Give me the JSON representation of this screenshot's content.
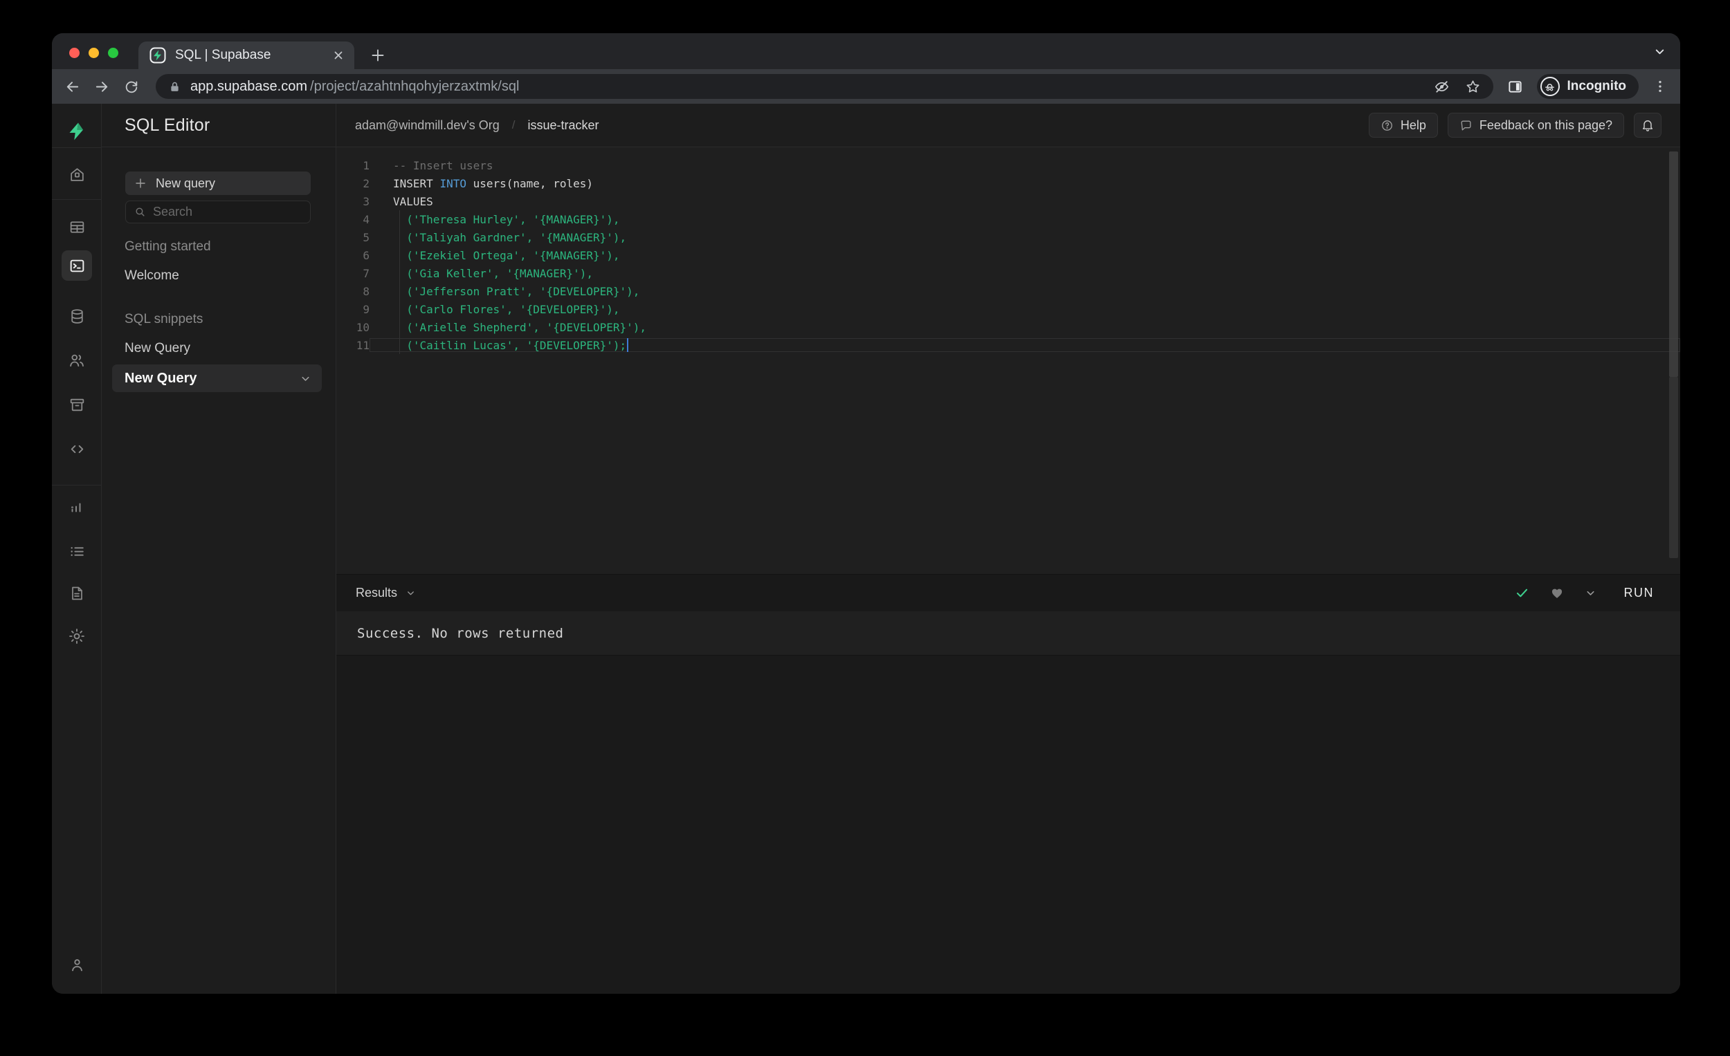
{
  "browser": {
    "tab_title": "SQL | Supabase",
    "url_domain": "app.supabase.com",
    "url_path": "/project/azahtnhqohyjerzaxtmk/sql",
    "incognito_label": "Incognito"
  },
  "sidebar": {
    "items": [
      "home",
      "table-editor",
      "sql-editor",
      "database",
      "authentication",
      "storage",
      "api",
      "reports",
      "logs",
      "docs",
      "settings",
      "account"
    ],
    "active": "sql-editor"
  },
  "panel": {
    "title": "SQL Editor",
    "new_query_button": "New query",
    "search_placeholder": "Search",
    "sections": [
      {
        "label": "Getting started",
        "items": [
          {
            "label": "Welcome",
            "selected": false
          }
        ]
      },
      {
        "label": "SQL snippets",
        "items": [
          {
            "label": "New Query",
            "selected": false
          },
          {
            "label": "New Query",
            "selected": true
          }
        ]
      }
    ]
  },
  "header": {
    "org": "adam@windmill.dev's Org",
    "separator": "/",
    "project": "issue-tracker",
    "help": "Help",
    "feedback": "Feedback on this page?"
  },
  "editor": {
    "lines": [
      {
        "num": 1,
        "tokens": [
          {
            "c": "comment",
            "t": "-- Insert users"
          }
        ]
      },
      {
        "num": 2,
        "tokens": [
          {
            "c": "plain",
            "t": "INSERT "
          },
          {
            "c": "kw",
            "t": "INTO"
          },
          {
            "c": "plain",
            "t": " users(name, roles)"
          }
        ]
      },
      {
        "num": 3,
        "tokens": [
          {
            "c": "plain",
            "t": "VALUES"
          }
        ]
      },
      {
        "num": 4,
        "tokens": [
          {
            "c": "str",
            "t": "  ('Theresa Hurley', '{MANAGER}'),"
          }
        ]
      },
      {
        "num": 5,
        "tokens": [
          {
            "c": "str",
            "t": "  ('Taliyah Gardner', '{MANAGER}'),"
          }
        ]
      },
      {
        "num": 6,
        "tokens": [
          {
            "c": "str",
            "t": "  ('Ezekiel Ortega', '{MANAGER}'),"
          }
        ]
      },
      {
        "num": 7,
        "tokens": [
          {
            "c": "str",
            "t": "  ('Gia Keller', '{MANAGER}'),"
          }
        ]
      },
      {
        "num": 8,
        "tokens": [
          {
            "c": "str",
            "t": "  ('Jefferson Pratt', '{DEVELOPER}'),"
          }
        ]
      },
      {
        "num": 9,
        "tokens": [
          {
            "c": "str",
            "t": "  ('Carlo Flores', '{DEVELOPER}'),"
          }
        ]
      },
      {
        "num": 10,
        "tokens": [
          {
            "c": "str",
            "t": "  ('Arielle Shepherd', '{DEVELOPER}'),"
          }
        ]
      },
      {
        "num": 11,
        "tokens": [
          {
            "c": "str",
            "t": "  ('Caitlin Lucas', '{DEVELOPER}');"
          }
        ],
        "current": true,
        "cursor": true
      }
    ]
  },
  "results": {
    "label": "Results",
    "run": "RUN"
  },
  "status": {
    "message": "Success. No rows returned"
  },
  "colors": {
    "accent": "#3ecf8e",
    "keyword": "#569cd6",
    "string": "#2cb57e",
    "comment": "#6d6d6d",
    "cursor": "#3e7bd6",
    "success_check": "#3ecf8e"
  }
}
